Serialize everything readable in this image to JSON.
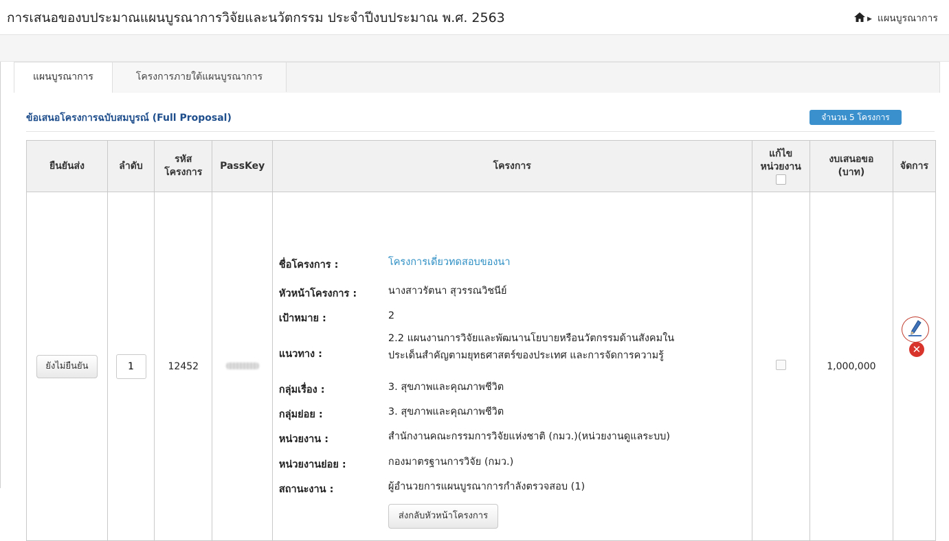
{
  "page": {
    "title": "การเสนอของบประมาณแผนบูรณาการวิจัยและนวัตกรรม ประจำปีงบประมาณ พ.ศ. 2563",
    "breadcrumb": {
      "home_icon": "home-icon",
      "current": "แผนบูรณาการ"
    }
  },
  "tabs": [
    {
      "label": "แผนบูรณาการ",
      "active": true
    },
    {
      "label": "โครงการภายใต้แผนบูรณาการ",
      "active": false
    }
  ],
  "panel": {
    "title": "ข้อเสนอโครงการฉบับสมบูรณ์ (Full Proposal)",
    "count_badge": "จำนวน 5 โครงการ"
  },
  "table": {
    "headers": {
      "confirm": "ยืนยันส่ง",
      "order": "ลำดับ",
      "code": "รหัส\nโครงการ",
      "passkey": "PassKey",
      "project": "โครงการ",
      "edit_unit": "แก้ไข\nหน่วยงาน",
      "budget": "งบเสนอขอ\n(บาท)",
      "manage": "จัดการ"
    },
    "rows": [
      {
        "confirm_button": "ยังไม่ยืนยัน",
        "order": "1",
        "code": "12452",
        "passkey_hidden": true,
        "project_name_label": "ชื่อโครงการ :",
        "project_name": "โครงการเดี่ยวทดสอบของนา",
        "lead_label": "หัวหน้าโครงการ :",
        "lead": "นางสาวรัตนา สุวรรณวิชนีย์",
        "target_label": "เป้าหมาย :",
        "target": "2",
        "approach_label": "แนวทาง :",
        "approach_line1": "2.2 แผนงานการวิจัยและพัฒนานโยบายหรือนวัตกรรมด้านสังคมใน",
        "approach_line2": "ประเด็นสำคัญตามยุทธศาสตร์ของประเทศ และการจัดการความรู้",
        "group_label": "กลุ่มเรื่อง :",
        "group": "3. สุขภาพและคุณภาพชีวิต",
        "subgroup_label": "กลุ่มย่อย :",
        "subgroup": "3. สุขภาพและคุณภาพชีวิต",
        "unit_label": "หน่วยงาน :",
        "unit": "สำนักงานคณะกรรมการวิจัยแห่งชาติ (กมว.)(หน่วยงานดูแลระบบ)",
        "subunit_label": "หน่วยงานย่อย :",
        "subunit": "กองมาตรฐานการวิจัย (กมว.)",
        "status_label": "สถานะงาน :",
        "status": "ผู้อำนวยการแผนบูรณาการกำลังตรวจสอบ (1)",
        "return_button": "ส่งกลับหัวหน้าโครงการ",
        "budget": "1,000,000",
        "edit_icon": "pencil-icon",
        "delete_icon": "delete-icon"
      }
    ]
  },
  "colors": {
    "link": "#2e8fc4",
    "badge": "#3a8fcd",
    "title_blue": "#1f4e8c",
    "delete": "#d9342b"
  }
}
